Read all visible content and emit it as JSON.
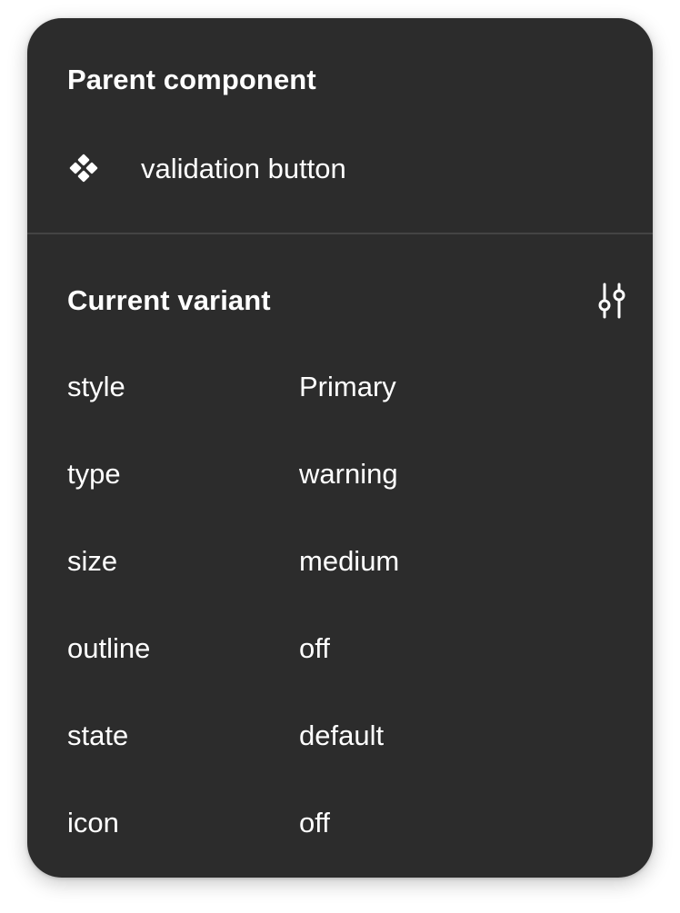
{
  "parent_section": {
    "title": "Parent component",
    "component": {
      "icon": "component-icon",
      "name": "validation button"
    }
  },
  "variant_section": {
    "title": "Current variant",
    "settings_icon": "sliders-icon",
    "properties": [
      {
        "name": "style",
        "value": "Primary"
      },
      {
        "name": "type",
        "value": "warning"
      },
      {
        "name": "size",
        "value": "medium"
      },
      {
        "name": "outline",
        "value": "off"
      },
      {
        "name": "state",
        "value": "default"
      },
      {
        "name": "icon",
        "value": "off"
      }
    ]
  },
  "colors": {
    "panel_background": "#2c2c2c",
    "text": "#ffffff",
    "divider": "#444444"
  }
}
